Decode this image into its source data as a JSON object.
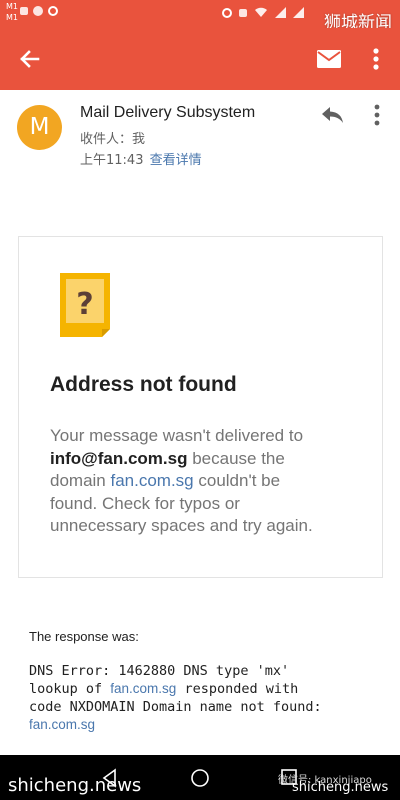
{
  "status_bar": {
    "carrier_1": "M1",
    "carrier_2": "M1",
    "icons": [
      "sim-badge-icon",
      "notification-icon",
      "app-icon",
      "alarm-icon",
      "vibrate-icon",
      "wifi-icon",
      "signal-icon",
      "signal-icon",
      "battery-icon"
    ]
  },
  "watermarks": {
    "top_right": "狮城新闻",
    "bottom_left": "shicheng.news",
    "wechat": "微信号: kanxinjiapo",
    "bottom_right": "shicheng.news"
  },
  "toolbar": {
    "back_icon": "arrow-back-icon",
    "mail_icon": "envelope-icon",
    "more_icon": "more-vert-icon",
    "color": "#e9533d"
  },
  "header": {
    "avatar_letter": "M",
    "avatar_color": "#f2a622",
    "sender": "Mail Delivery Subsystem",
    "recipient": "收件人：我",
    "time": "上午11:43",
    "details_link": "查看详情"
  },
  "card": {
    "icon": "question-mark-icon",
    "title": "Address not found",
    "body_1": "Your message wasn't delivered to",
    "email": "info@fan.com.sg",
    "body_2": " because the",
    "body_3": "domain ",
    "domain": "fan.com.sg",
    "body_4": " couldn't be",
    "body_5": "found. Check for typos or",
    "body_6": "unnecessary spaces and try again."
  },
  "response": {
    "label": "The response was:",
    "line_1": "DNS Error: 1462880 DNS type 'mx'",
    "line_2_prefix": "lookup of ",
    "line_2_link": "fan.com.sg",
    "line_2_suffix": " responded with",
    "line_3": "code NXDOMAIN Domain name not found:",
    "line_4_link": "fan.com.sg"
  },
  "nav_bar": {
    "back_icon": "nav-back-icon",
    "home_icon": "nav-home-icon",
    "recents_icon": "nav-recents-icon"
  }
}
